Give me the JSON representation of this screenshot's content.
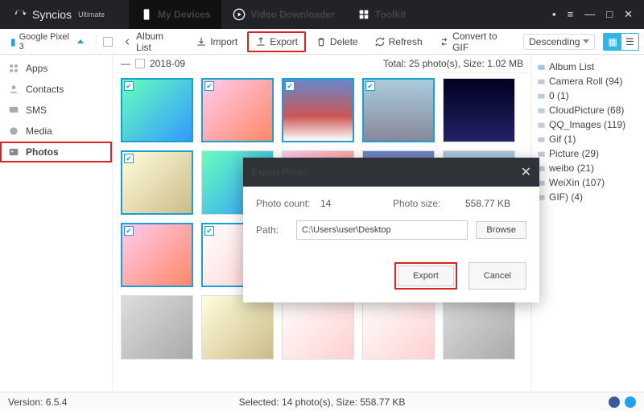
{
  "app": {
    "name": "Syncios",
    "edition": "Ultimate"
  },
  "topTabs": [
    {
      "label": "My Devices",
      "icon": "phone"
    },
    {
      "label": "Video Downloader",
      "icon": "play"
    },
    {
      "label": "Toolkit",
      "icon": "grid"
    }
  ],
  "device": {
    "name": "Google Pixel 3"
  },
  "toolbar": {
    "albumList": "Album List",
    "import": "Import",
    "export": "Export",
    "delete": "Delete",
    "refresh": "Refresh",
    "convertGif": "Convert to GIF",
    "sort": "Descending"
  },
  "sidebar": [
    {
      "label": "Apps",
      "icon": "apps"
    },
    {
      "label": "Contacts",
      "icon": "contacts"
    },
    {
      "label": "SMS",
      "icon": "sms"
    },
    {
      "label": "Media",
      "icon": "media"
    },
    {
      "label": "Photos",
      "icon": "photos",
      "active": true
    }
  ],
  "albumHeader": {
    "date": "2018-09",
    "total": "Total: 25 photo(s), Size: 1.02 MB"
  },
  "albumList": [
    {
      "label": "Album List"
    },
    {
      "label": "Camera Roll (94)"
    },
    {
      "label": "0 (1)"
    },
    {
      "label": "CloudPicture (68)"
    },
    {
      "label": "QQ_Images (119)"
    },
    {
      "label": "Gif (1)"
    },
    {
      "label": "Picture (29)"
    },
    {
      "label": "weibo (21)"
    },
    {
      "label": "WeiXin (107)"
    },
    {
      "label": "GIF) (4)"
    }
  ],
  "modal": {
    "title": "Export Photo",
    "photoCountLbl": "Photo count:",
    "photoCount": "14",
    "photoSizeLbl": "Photo size:",
    "photoSize": "558.77 KB",
    "pathLbl": "Path:",
    "path": "C:\\Users\\user\\Desktop",
    "browse": "Browse",
    "export": "Export",
    "cancel": "Cancel"
  },
  "status": {
    "version": "Version: 6.5.4",
    "selected": "Selected: 14 photo(s), Size: 558.77 KB"
  }
}
